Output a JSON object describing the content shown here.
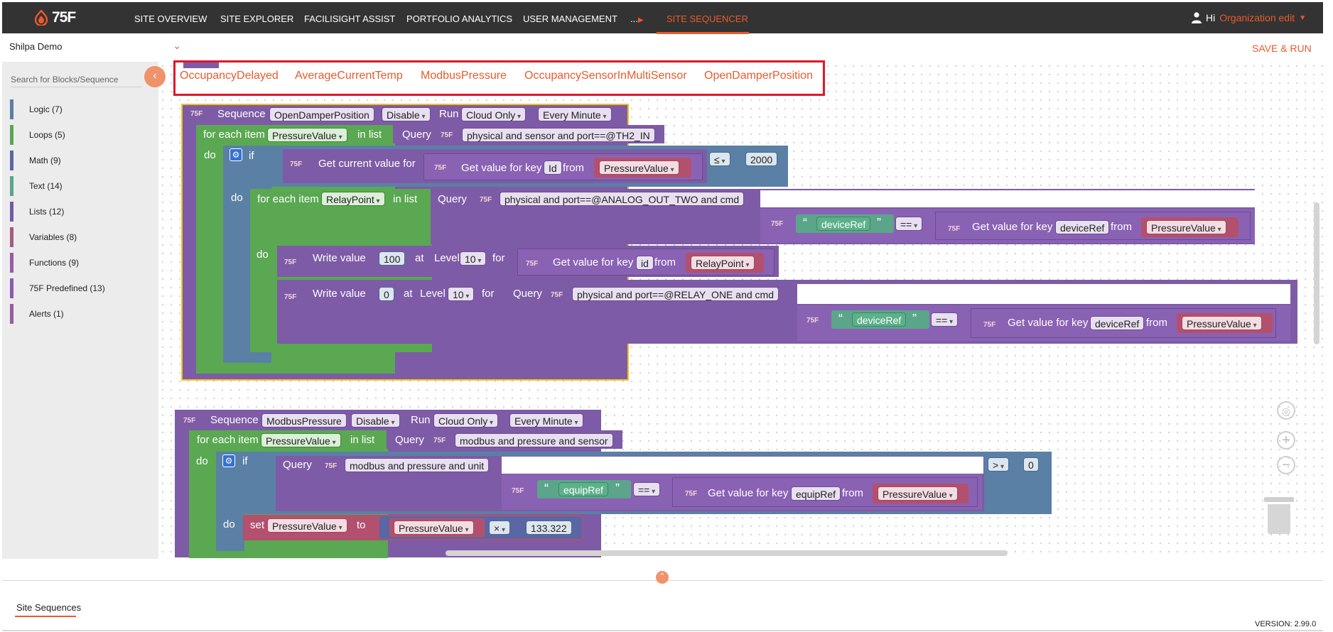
{
  "brand": {
    "logo_text": "75F",
    "accent": "#e95a2c"
  },
  "nav": {
    "items": [
      "SITE OVERVIEW",
      "SITE EXPLORER",
      "FACILISIGHT ASSIST",
      "PORTFOLIO ANALYTICS",
      "USER MANAGEMENT",
      "...",
      "SITE SEQUENCER"
    ],
    "active": "SITE SEQUENCER"
  },
  "user": {
    "greeting": "Hi",
    "org_label": "Organization edit"
  },
  "site_select": {
    "value": "Shilpa Demo"
  },
  "toolbar": {
    "save_run_label": "SAVE & RUN"
  },
  "sidebar": {
    "search_placeholder": "Search for Blocks/Sequence",
    "categories": [
      {
        "label": "Logic (7)",
        "color": "#5b80a5"
      },
      {
        "label": "Loops (5)",
        "color": "#5ba55b"
      },
      {
        "label": "Math (9)",
        "color": "#5b67a5"
      },
      {
        "label": "Text (14)",
        "color": "#5ba58c"
      },
      {
        "label": "Lists (12)",
        "color": "#745ba5"
      },
      {
        "label": "Variables (8)",
        "color": "#a55b80"
      },
      {
        "label": "Functions (9)",
        "color": "#995ba5"
      },
      {
        "label": "75F Predefined (13)",
        "color": "#8a5bb0"
      },
      {
        "label": "Alerts (1)",
        "color": "#995ba5"
      }
    ]
  },
  "sequence_tabs": [
    "OccupancyDelayed",
    "AverageCurrentTemp",
    "ModbusPressure",
    "OccupancySensorInMultiSensor",
    "OpenDamperPosition"
  ],
  "blocks": {
    "tag": "75F",
    "seq1": {
      "kw_sequence": "Sequence",
      "name": "OpenDamperPosition",
      "state": "Disable",
      "kw_run": "Run",
      "run_mode": "Cloud Only",
      "frequency": "Every Minute",
      "foreach_kw": "for each item",
      "foreach_var": "PressureValue",
      "in_list": "in list",
      "query_kw": "Query",
      "query1": "physical and sensor and port==@TH2_IN",
      "do": "do",
      "if": "if",
      "get_current": "Get current value for",
      "get_value_key": "Get value for key",
      "key_id": "Id",
      "from": "from",
      "var_pressure": "PressureValue",
      "op_le": "≤",
      "num_2000": "2000",
      "foreach_var2": "RelayPoint",
      "query2": "physical and port==@ANALOG_OUT_TWO and cmd",
      "str_deviceref": "deviceRef",
      "op_eq": "==",
      "key_deviceref": "deviceRef",
      "write_value": "Write value",
      "num_100": "100",
      "at": "at",
      "level": "Level",
      "num_10": "10",
      "for": "for",
      "key_id2": "id",
      "var_relay": "RelayPoint",
      "num_0": "0",
      "query3": "physical and port==@RELAY_ONE and cmd"
    },
    "seq2": {
      "name": "ModbusPressure",
      "state": "Disable",
      "run_mode": "Cloud Only",
      "frequency": "Every Minute",
      "foreach_var": "PressureValue",
      "query1": "modbus and pressure and sensor",
      "query2": "modbus and pressure and unit",
      "op_gt": ">",
      "num_0": "0",
      "str_equipref": "equipRef",
      "op_eq": "==",
      "key_equipref": "equipRef",
      "var_pressure": "PressureValue",
      "set": "set",
      "to": "to",
      "op_mul": "×",
      "num_factor": "133.322"
    }
  },
  "bottom": {
    "tab_label": "Site Sequences",
    "version": "VERSION: 2.99.0"
  }
}
